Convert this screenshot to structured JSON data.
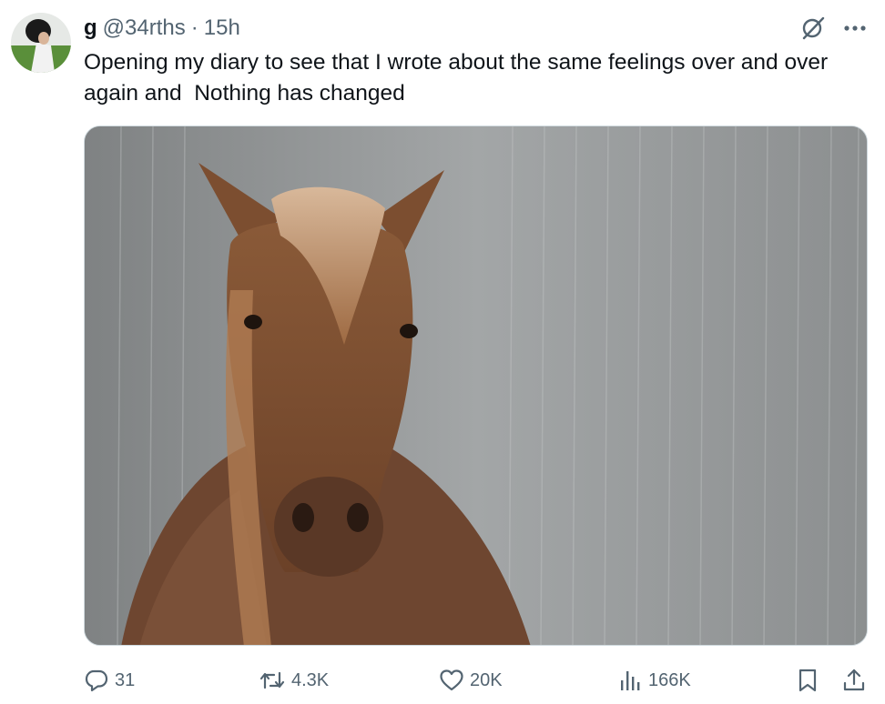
{
  "tweet": {
    "display_name": "g",
    "handle": "@34rths",
    "separator": "·",
    "time": "15h",
    "text": "Opening my diary to see that I wrote about the same feelings over and over\nagain and  Nothing has changed"
  },
  "actions": {
    "replies": "31",
    "reposts": "4.3K",
    "likes": "20K",
    "views": "166K"
  },
  "icons": {
    "grok": "grok-icon",
    "more": "more-icon",
    "reply": "reply-icon",
    "repost": "repost-icon",
    "like": "heart-icon",
    "views": "views-icon",
    "bookmark": "bookmark-icon",
    "share": "share-icon"
  },
  "colors": {
    "text": "#0f1419",
    "secondary": "#536471",
    "border": "#cfd9de"
  }
}
